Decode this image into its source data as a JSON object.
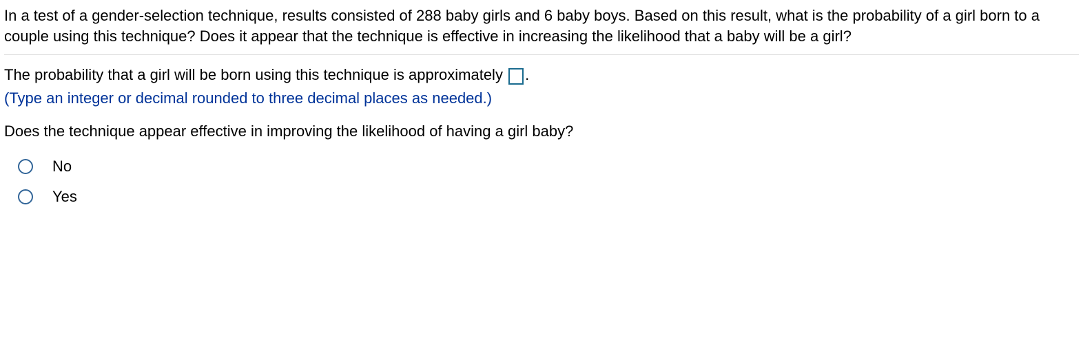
{
  "question": {
    "text": "In a test of a gender-selection technique, results consisted of 288 baby girls and 6 baby boys. Based on this result, what is the probability of a girl born to a couple using this technique? Does it appear that the technique is effective in increasing the likelihood that a baby will be a girl?"
  },
  "answer": {
    "probability_prefix": "The probability that a girl will be born using this technique is approximately ",
    "probability_suffix": ".",
    "instruction": "(Type an integer or decimal rounded to three decimal places as needed.)",
    "followup": "Does the technique appear effective in improving the likelihood of having a girl baby?"
  },
  "options": [
    {
      "label": "No"
    },
    {
      "label": "Yes"
    }
  ]
}
